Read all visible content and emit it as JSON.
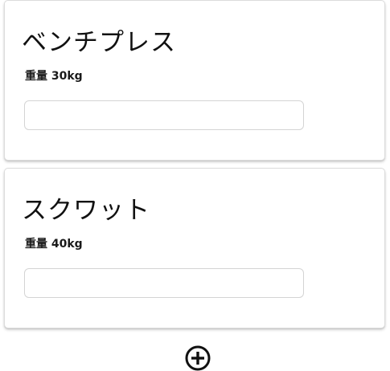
{
  "exercises": [
    {
      "name": "ベンチプレス",
      "weight_label": "重量 30kg",
      "input_value": "",
      "input_placeholder": ""
    },
    {
      "name": "スクワット",
      "weight_label": "重量 40kg",
      "input_value": "",
      "input_placeholder": ""
    }
  ],
  "add_button": {
    "icon": "plus-circle-icon"
  },
  "colors": {
    "text": "#111111",
    "card_border": "#dcdcdc",
    "input_border": "#d4d4d4"
  }
}
